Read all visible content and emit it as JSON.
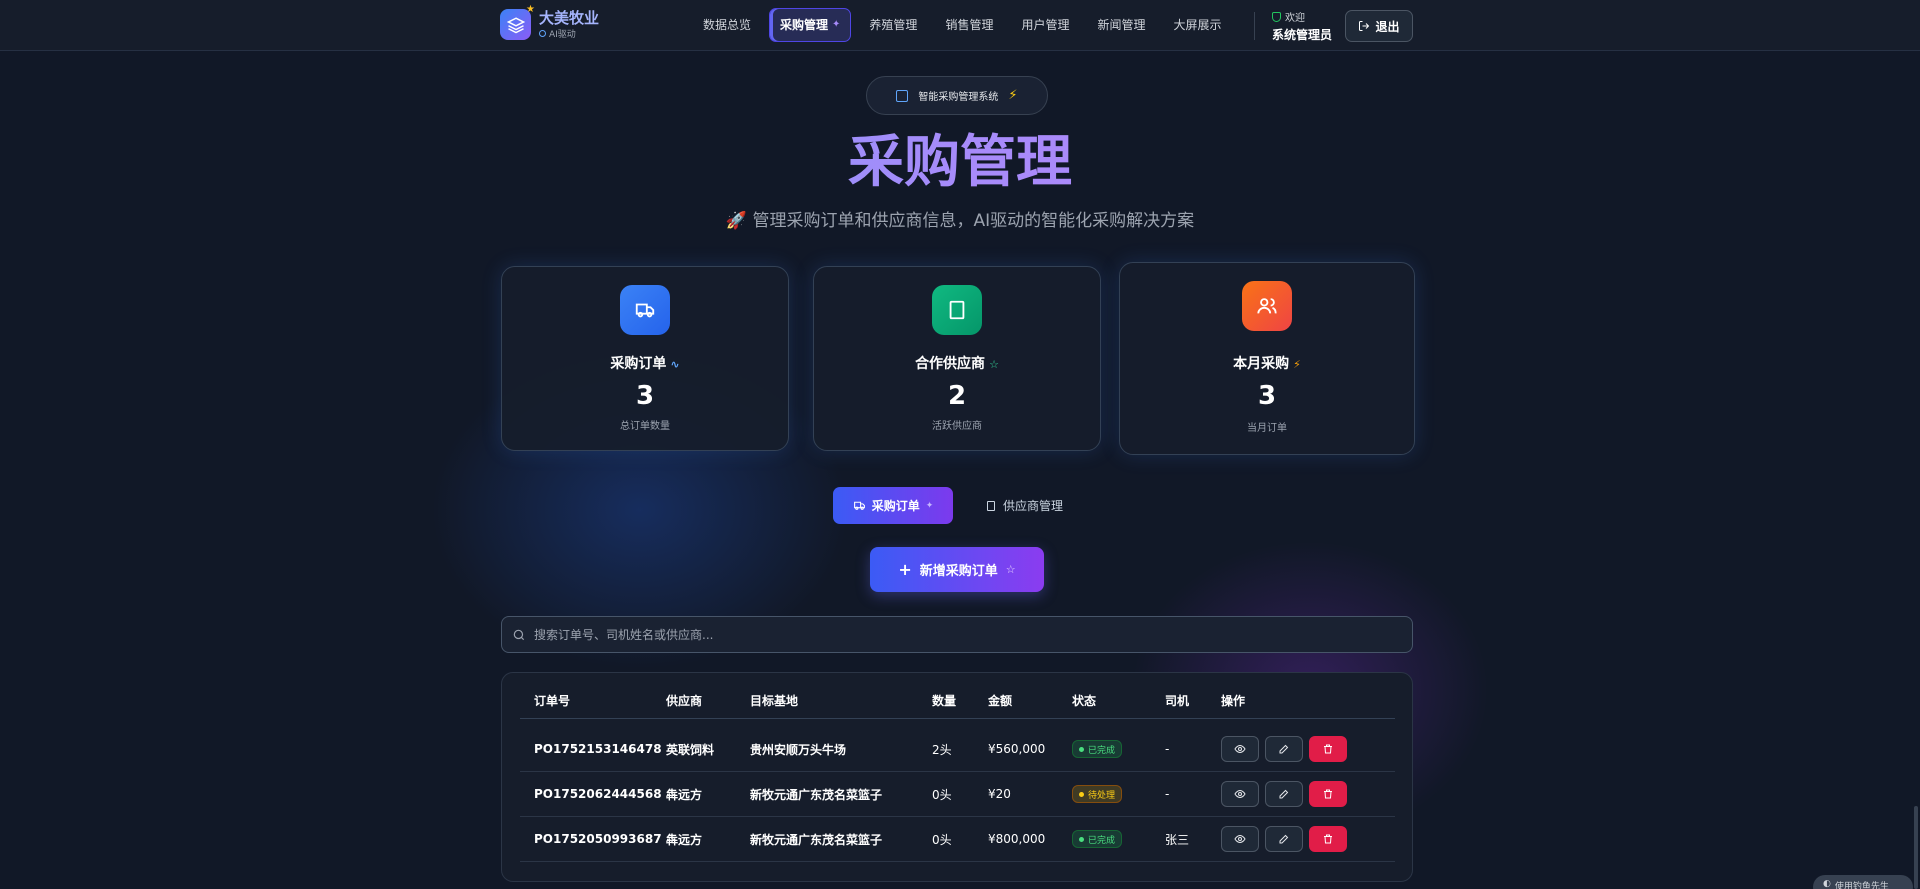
{
  "brand": {
    "name": "大美牧业",
    "sub": "AI驱动"
  },
  "nav": {
    "items": [
      {
        "label": "数据总览"
      },
      {
        "label": "采购管理",
        "active": true
      },
      {
        "label": "养殖管理"
      },
      {
        "label": "销售管理"
      },
      {
        "label": "用户管理"
      },
      {
        "label": "新闻管理"
      },
      {
        "label": "大屏展示"
      }
    ],
    "welcome": "欢迎",
    "user": "系统管理员",
    "logout": "退出"
  },
  "hero": {
    "pill": "智能采购管理系统",
    "title": "采购管理",
    "subtitle": "🚀 管理采购订单和供应商信息，AI驱动的智能化采购解决方案"
  },
  "stats": [
    {
      "title": "采购订单",
      "value": "3",
      "desc": "总订单数量",
      "icon": "truck-icon",
      "color": "#3b82f6"
    },
    {
      "title": "合作供应商",
      "value": "2",
      "desc": "活跃供应商",
      "icon": "building-icon",
      "color": "#10b981"
    },
    {
      "title": "本月采购",
      "value": "3",
      "desc": "当月订单",
      "icon": "users-icon",
      "color": "#f97316"
    }
  ],
  "tabs": {
    "orders": "采购订单",
    "suppliers": "供应商管理"
  },
  "add_button": "新增采购订单",
  "search": {
    "placeholder": "搜索订单号、司机姓名或供应商...",
    "value": ""
  },
  "table": {
    "headers": [
      "订单号",
      "供应商",
      "目标基地",
      "数量",
      "金额",
      "状态",
      "司机",
      "操作"
    ],
    "rows": [
      {
        "order_no": "PO1752153146478",
        "supplier": "英联饲料",
        "base": "贵州安顺万头牛场",
        "qty": "2头",
        "amount": "¥560,000",
        "status": "已完成",
        "status_type": "done",
        "driver": "-"
      },
      {
        "order_no": "PO1752062444568",
        "supplier": "犇远方",
        "base": "新牧元通广东茂名菜篮子",
        "qty": "0头",
        "amount": "¥20",
        "status": "待处理",
        "status_type": "pending",
        "driver": "-"
      },
      {
        "order_no": "PO1752050993687",
        "supplier": "犇远方",
        "base": "新牧元通广东茂名菜篮子",
        "qty": "0头",
        "amount": "¥800,000",
        "status": "已完成",
        "status_type": "done",
        "driver": "张三"
      }
    ]
  },
  "corner_badge": "使用钓鱼先生"
}
